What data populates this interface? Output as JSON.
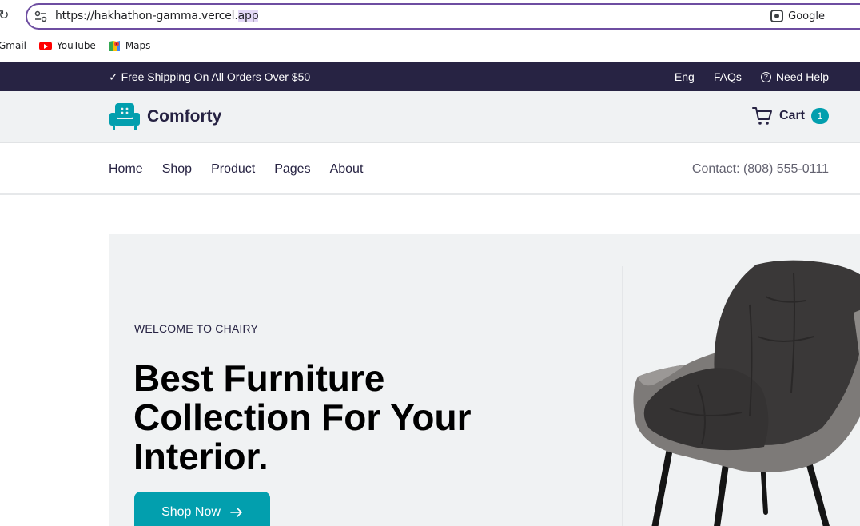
{
  "browser": {
    "url_main": "https://hakhathon-gamma.vercel.",
    "url_selected": "app",
    "lens_label": "Google",
    "bookmarks": [
      {
        "label": "Gmail",
        "icon": "gmail-icon"
      },
      {
        "label": "YouTube",
        "icon": "youtube-icon"
      },
      {
        "label": "Maps",
        "icon": "maps-icon"
      }
    ]
  },
  "topbar": {
    "shipping": "✓ Free Shipping On All Orders Over $50",
    "lang": "Eng",
    "faqs": "FAQs",
    "help": "Need Help"
  },
  "header": {
    "logo_text": "Comforty",
    "cart_label": "Cart",
    "cart_count": "1"
  },
  "nav": {
    "items": [
      "Home",
      "Shop",
      "Product",
      "Pages",
      "About"
    ],
    "contact": "Contact: (808) 555-0111"
  },
  "hero": {
    "welcome": "WELCOME TO CHAIRY",
    "headline": "Best Furniture Collection For Your Interior.",
    "button": "Shop Now",
    "button_icon": "arrow-right-icon"
  },
  "colors": {
    "brand_dark": "#272343",
    "accent": "#029fae",
    "hero_bg": "#f0f2f3"
  }
}
